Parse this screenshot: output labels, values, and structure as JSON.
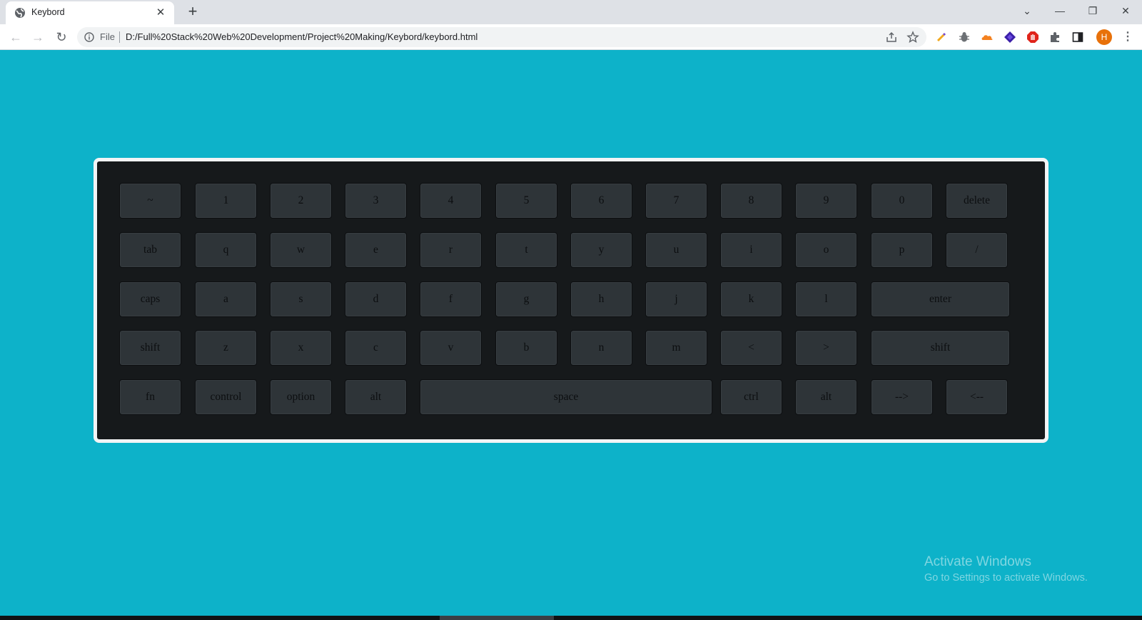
{
  "browser": {
    "tab": {
      "title": "Keybord",
      "close_glyph": "✕",
      "favicon": "globe-icon"
    },
    "new_tab_glyph": "+",
    "window_controls": {
      "dropdown": "⌄",
      "minimize": "—",
      "restore": "❐",
      "close": "✕"
    },
    "nav": {
      "back": "←",
      "forward": "→",
      "reload": "↻"
    },
    "address": {
      "scheme_label": "File",
      "url": "D:/Full%20Stack%20Web%20Development/Project%20Making/Keybord/keybord.html"
    },
    "profile_initial": "H",
    "menu_glyph": "⋮"
  },
  "keyboard": {
    "rows": [
      [
        "~",
        "1",
        "2",
        "3",
        "4",
        "5",
        "6",
        "7",
        "8",
        "9",
        "0",
        "delete"
      ],
      [
        "tab",
        "q",
        "w",
        "e",
        "r",
        "t",
        "y",
        "u",
        "i",
        "o",
        "p",
        "/"
      ],
      [
        "caps",
        "a",
        "s",
        "d",
        "f",
        "g",
        "h",
        "j",
        "k",
        "l",
        "enter"
      ],
      [
        "shift",
        "z",
        "x",
        "c",
        "v",
        "b",
        "n",
        "m",
        "<",
        ">",
        "shift"
      ],
      [
        "fn",
        "control",
        "option",
        "alt",
        "space",
        "ctrl",
        "alt",
        "-->",
        "<--"
      ]
    ]
  },
  "watermark": {
    "title": "Activate Windows",
    "subtitle": "Go to Settings to activate Windows."
  },
  "colors": {
    "page_background": "#0db2c9",
    "keyboard_body": "#16191b",
    "keyboard_border": "#f2f4f5",
    "key_face": "#2e3438",
    "key_label": "#0c0e10"
  }
}
